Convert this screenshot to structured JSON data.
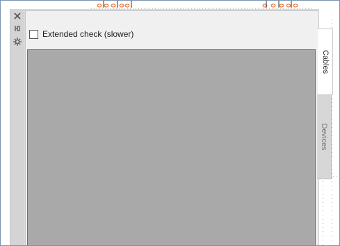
{
  "sidebar": {
    "close_icon": "close-icon",
    "pin_icon": "pin-icon",
    "settings_icon": "gear-icon"
  },
  "toolbar": {
    "extended_check_label": "Extended check (slower)",
    "extended_check_checked": false
  },
  "tabs": [
    {
      "label": "Cables",
      "active": true
    },
    {
      "label": "Devices",
      "active": false
    }
  ],
  "colors": {
    "panel_bg": "#f0f0f0",
    "canvas_gray": "#a9a9a9",
    "window_border": "#7a94b0",
    "drawing_marks": "#e07030"
  }
}
